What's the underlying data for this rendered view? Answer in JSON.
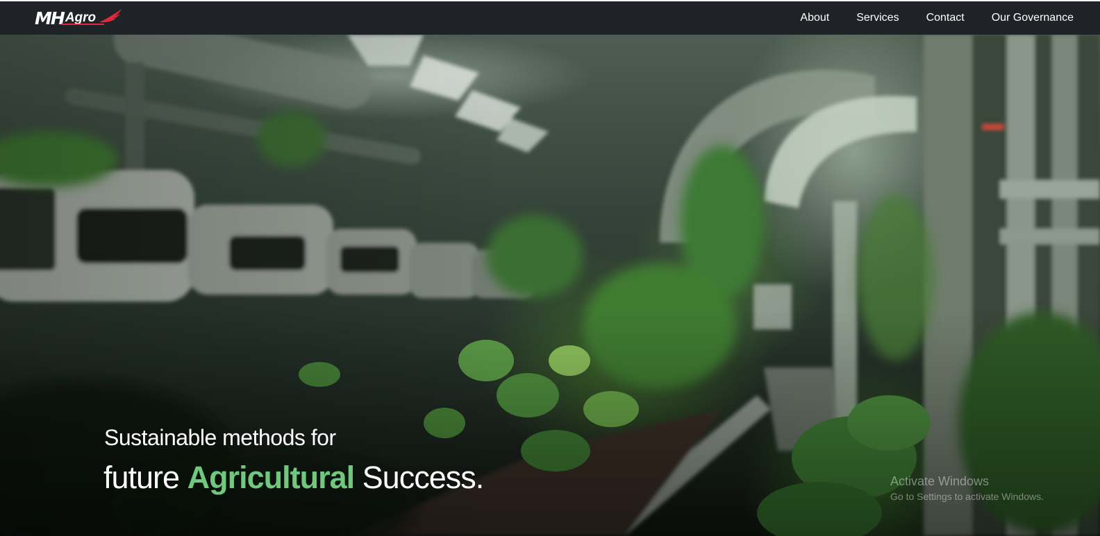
{
  "brand": {
    "mark": "MH",
    "name": "Agro",
    "accent_color": "#e2283c"
  },
  "nav": {
    "items": [
      "About",
      "Services",
      "Contact",
      "Our Governance"
    ]
  },
  "hero": {
    "line1": "Sustainable methods for",
    "line2_start": "future",
    "line2_accent": "Agricultural",
    "line2_end": "Success.",
    "accent_color": "#6fc87d"
  },
  "watermark": {
    "title": "Activate Windows",
    "subtitle": "Go to Settings to activate Windows."
  },
  "colors": {
    "navbar_bg": "#1f2328",
    "text": "#ffffff"
  }
}
